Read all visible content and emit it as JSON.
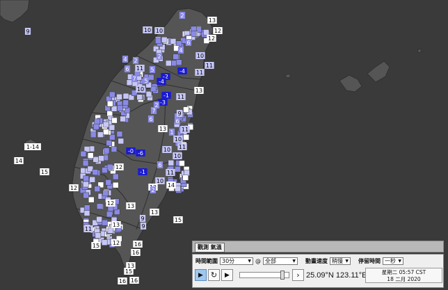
{
  "map": {
    "colors": {
      "background": "#3a3a3a",
      "land": "#555555",
      "county_border": "#2e2e2e",
      "level_low": "#8a8ae6",
      "level_mid": "#c6c6f6",
      "level_cold": "#1a1ad0",
      "level_white": "#ffffff"
    },
    "readings": [
      {
        "v": "9"
      },
      {
        "v": "13"
      },
      {
        "v": "2"
      },
      {
        "v": "12"
      },
      {
        "v": "10"
      },
      {
        "v": "10"
      },
      {
        "v": "12"
      },
      {
        "v": "6"
      },
      {
        "v": "10"
      },
      {
        "v": "11"
      },
      {
        "v": "2"
      },
      {
        "v": "4"
      },
      {
        "v": "6"
      },
      {
        "v": "11"
      },
      {
        "v": "2"
      },
      {
        "v": "4"
      },
      {
        "v": "5"
      },
      {
        "v": "7"
      },
      {
        "v": "11"
      },
      {
        "v": "-2"
      },
      {
        "v": "-4"
      },
      {
        "v": "-4"
      },
      {
        "v": "5"
      },
      {
        "v": "10"
      },
      {
        "v": "13"
      },
      {
        "v": "11"
      },
      {
        "v": "8"
      },
      {
        "v": "-1"
      },
      {
        "v": "-3"
      },
      {
        "v": "2"
      },
      {
        "v": "9"
      },
      {
        "v": "7"
      },
      {
        "v": "6"
      },
      {
        "v": "13"
      },
      {
        "v": "1"
      },
      {
        "v": "6"
      },
      {
        "v": "10"
      },
      {
        "v": "10"
      },
      {
        "v": "11"
      },
      {
        "v": "10"
      },
      {
        "v": "11"
      },
      {
        "v": "1-14"
      },
      {
        "v": "14"
      },
      {
        "v": "15"
      },
      {
        "v": "-0"
      },
      {
        "v": "-6"
      },
      {
        "v": "12"
      },
      {
        "v": "-1"
      },
      {
        "v": "6"
      },
      {
        "v": "11"
      },
      {
        "v": "14"
      },
      {
        "v": "10"
      },
      {
        "v": "12"
      },
      {
        "v": "2"
      },
      {
        "v": "9"
      },
      {
        "v": "13"
      },
      {
        "v": "9"
      },
      {
        "v": "13"
      },
      {
        "v": "15"
      },
      {
        "v": "15"
      },
      {
        "v": "12"
      },
      {
        "v": "16"
      },
      {
        "v": "16"
      },
      {
        "v": "15"
      },
      {
        "v": "13"
      },
      {
        "v": "16"
      },
      {
        "v": "16"
      },
      {
        "v": "12"
      },
      {
        "v": "13"
      },
      {
        "v": "11"
      },
      {
        "v": "12"
      }
    ]
  },
  "panel": {
    "tab_label": "觀測 氣溫",
    "time_range_label": "時間範圍",
    "time_range_value": "30分",
    "at_symbol": "@",
    "scope_value": "全部",
    "anim_speed_label": "動畫速度",
    "anim_speed_value": "稍慢",
    "pause_label": "停留時間",
    "pause_value": "一秒",
    "coordinates": "25.09°N 123.11°E",
    "weekday_time": "星期二 05:57 CST",
    "date": "18 二月 2020",
    "slider_fraction": 0.9
  }
}
